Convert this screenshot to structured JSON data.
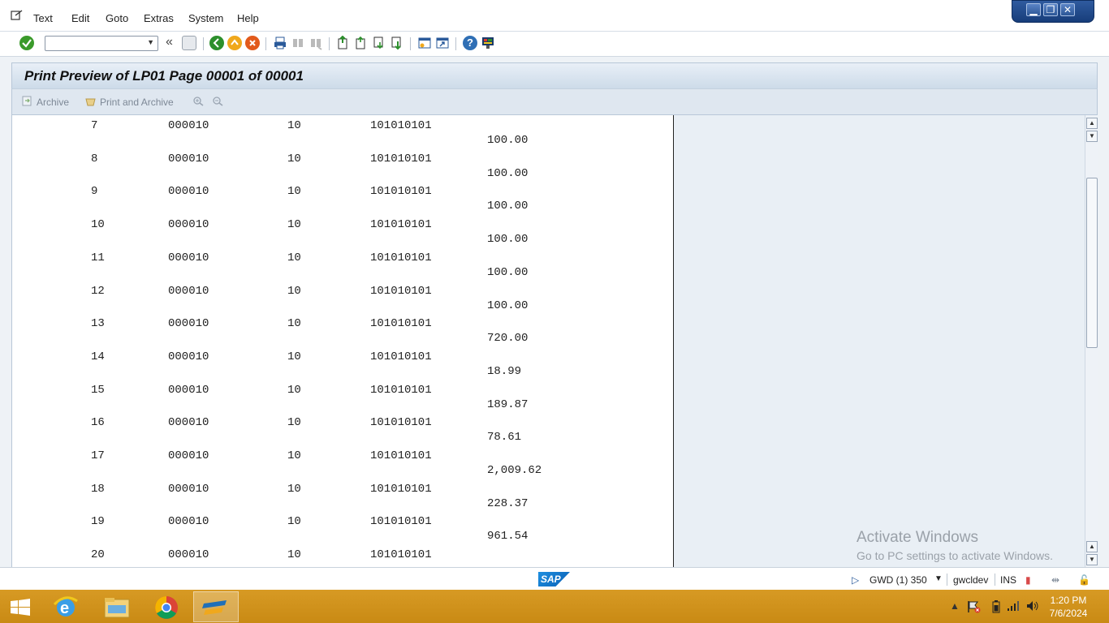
{
  "menu": {
    "items": [
      "Text",
      "Edit",
      "Goto",
      "Extras",
      "System",
      "Help"
    ]
  },
  "window_controls": {
    "minimize": "▁",
    "restore": "❐",
    "close": "✕"
  },
  "toolbar": {
    "command_field_value": "",
    "icons": [
      "enter-icon",
      "back-icon",
      "exit-icon",
      "cancel-icon",
      "print-icon",
      "find-icon",
      "find-next-icon",
      "first-page-icon",
      "previous-page-icon",
      "next-page-icon",
      "last-page-icon",
      "create-session-icon",
      "shortcut-icon",
      "help-icon",
      "customize-layout-icon"
    ]
  },
  "title": "Print Preview of LP01 Page 00001 of 00001",
  "app_toolbar": {
    "archive": "Archive",
    "print_and_archive": "Print and Archive"
  },
  "rows": [
    {
      "no": "7",
      "item": "000010",
      "qty": "10",
      "account": "101010101",
      "amount": "100.00"
    },
    {
      "no": "8",
      "item": "000010",
      "qty": "10",
      "account": "101010101",
      "amount": "100.00"
    },
    {
      "no": "9",
      "item": "000010",
      "qty": "10",
      "account": "101010101",
      "amount": "100.00"
    },
    {
      "no": "10",
      "item": "000010",
      "qty": "10",
      "account": "101010101",
      "amount": "100.00"
    },
    {
      "no": "11",
      "item": "000010",
      "qty": "10",
      "account": "101010101",
      "amount": "100.00"
    },
    {
      "no": "12",
      "item": "000010",
      "qty": "10",
      "account": "101010101",
      "amount": "100.00"
    },
    {
      "no": "13",
      "item": "000010",
      "qty": "10",
      "account": "101010101",
      "amount": "720.00"
    },
    {
      "no": "14",
      "item": "000010",
      "qty": "10",
      "account": "101010101",
      "amount": "18.99"
    },
    {
      "no": "15",
      "item": "000010",
      "qty": "10",
      "account": "101010101",
      "amount": "189.87"
    },
    {
      "no": "16",
      "item": "000010",
      "qty": "10",
      "account": "101010101",
      "amount": "78.61"
    },
    {
      "no": "17",
      "item": "000010",
      "qty": "10",
      "account": "101010101",
      "amount": "2,009.62"
    },
    {
      "no": "18",
      "item": "000010",
      "qty": "10",
      "account": "101010101",
      "amount": "228.37"
    },
    {
      "no": "19",
      "item": "000010",
      "qty": "10",
      "account": "101010101",
      "amount": "961.54"
    },
    {
      "no": "20",
      "item": "000010",
      "qty": "10",
      "account": "101010101",
      "amount": ""
    }
  ],
  "watermark": {
    "line1": "Activate Windows",
    "line2": "Go to PC settings to activate Windows."
  },
  "status": {
    "logo_text": "SAP",
    "system": "GWD (1) 350",
    "server": "gwcldev",
    "mode": "INS"
  },
  "taskbar": {
    "time": "1:20 PM",
    "date": "7/6/2024"
  }
}
